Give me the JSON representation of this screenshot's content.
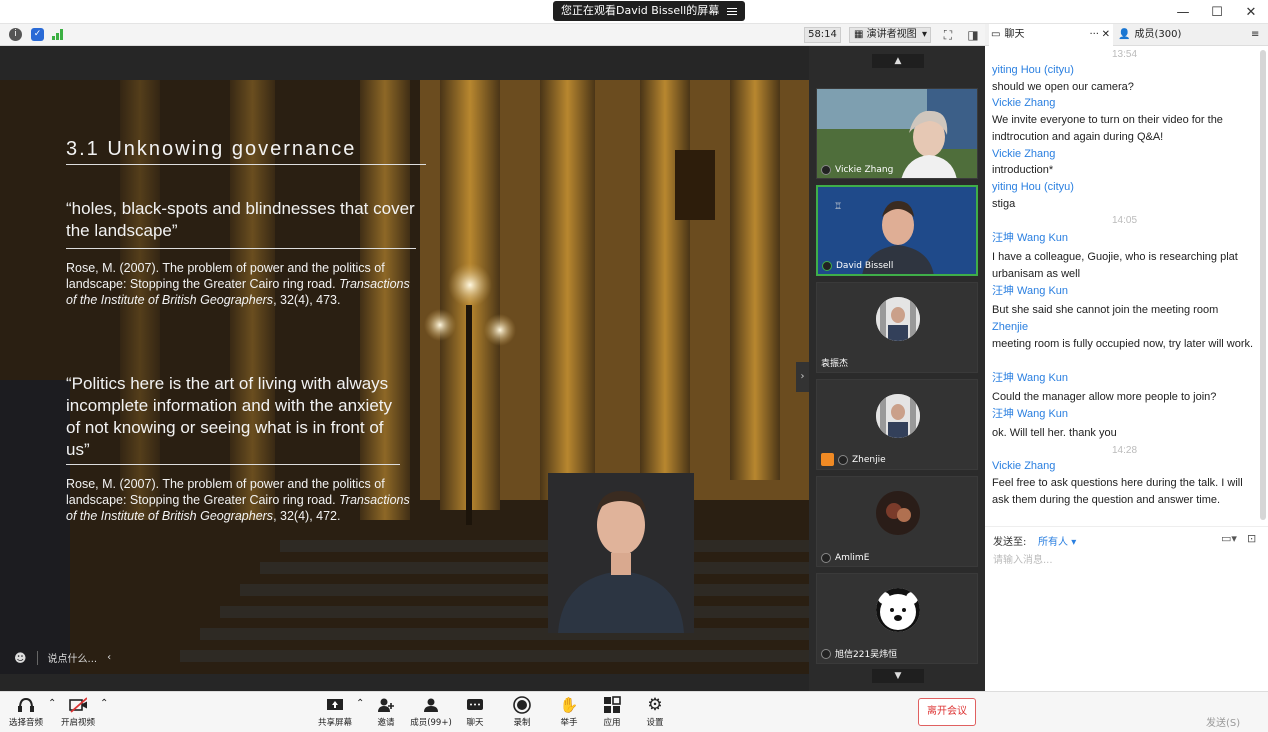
{
  "titlebar": {
    "share_notice": "您正在观看David Bissell的屏幕",
    "controls": [
      "—",
      "☐",
      "✕"
    ]
  },
  "toolbar": {
    "timer": "58:14",
    "view_mode": "演讲者视图"
  },
  "slide": {
    "title": "3.1 Unknowing governance",
    "quote1": "“holes, black-spots and blindnesses that cover the landscape”",
    "ref1_plain": "Rose, M. (2007). The problem of power and the politics of landscape: Stopping the Greater Cairo ring road.",
    "ref1_italic": "Transactions of the Institute of British Geographers",
    "ref1_tail": ", 32(4), 473.",
    "quote2": "“Politics here is the art of living with always incomplete information and with the anxiety of not knowing or seeing what is in front of us”",
    "ref2_plain": "Rose, M. (2007). The problem of power and the politics of landscape: Stopping the Greater Cairo ring road.",
    "ref2_italic": "Transactions of the Institute of British Geographers",
    "ref2_tail": ", 32(4), 472."
  },
  "stage": {
    "chat_placeholder": "说点什么..."
  },
  "participants": [
    {
      "name": "Vickie Zhang"
    },
    {
      "name": "David Bissell"
    },
    {
      "name": "袁振杰"
    },
    {
      "name": "Zhenjie"
    },
    {
      "name": "AmlimE"
    },
    {
      "name": "旭信221吴炜恒"
    }
  ],
  "chat_panel": {
    "tab_chat": "聊天",
    "tab_members": "成员(300)",
    "top_time": "13:54",
    "messages": [
      {
        "name": "yiting Hou (cityu)",
        "text": "should we open our camera?"
      },
      {
        "name": "Vickie Zhang",
        "text": "We invite everyone to turn on their video for the indtrocution and again during Q&A!"
      },
      {
        "name": "Vickie Zhang",
        "text": "introduction*"
      },
      {
        "name": "yiting Hou (cityu)",
        "text": "stiga"
      },
      {
        "time": "14:05"
      },
      {
        "name": "汪坤 Wang Kun",
        "text": "I have a colleague, Guojie, who is researching plat urbanisam as well"
      },
      {
        "name": "汪坤 Wang Kun",
        "text": "But she said she cannot join the meeting room"
      },
      {
        "name": "Zhenjie",
        "text": "meeting room is fully occupied now, try later will work."
      },
      {
        "name": "汪坤 Wang Kun",
        "text": "Could the manager allow more people to join?"
      },
      {
        "name": "汪坤 Wang Kun",
        "text": "ok. Will tell her. thank you"
      },
      {
        "time": "14:28"
      },
      {
        "name": "Vickie Zhang",
        "text": "Feel free to ask questions here during the talk. I will ask them during the question and answer time."
      }
    ],
    "send_to_label": "发送至:",
    "send_to_value": "所有人",
    "input_placeholder": "请输入消息...",
    "send_button": "发送(S)"
  },
  "bottombar": {
    "audio": "选择音频",
    "video": "开启视频",
    "share": "共享屏幕",
    "invite": "邀请",
    "members": "成员(99+)",
    "chat": "聊天",
    "record": "录制",
    "raise_hand": "举手",
    "apps": "应用",
    "settings": "设置",
    "leave": "离开会议"
  },
  "colors": {
    "chat_name": "#2a7fe0",
    "active_border": "#3fae49",
    "leave": "#d33333"
  }
}
